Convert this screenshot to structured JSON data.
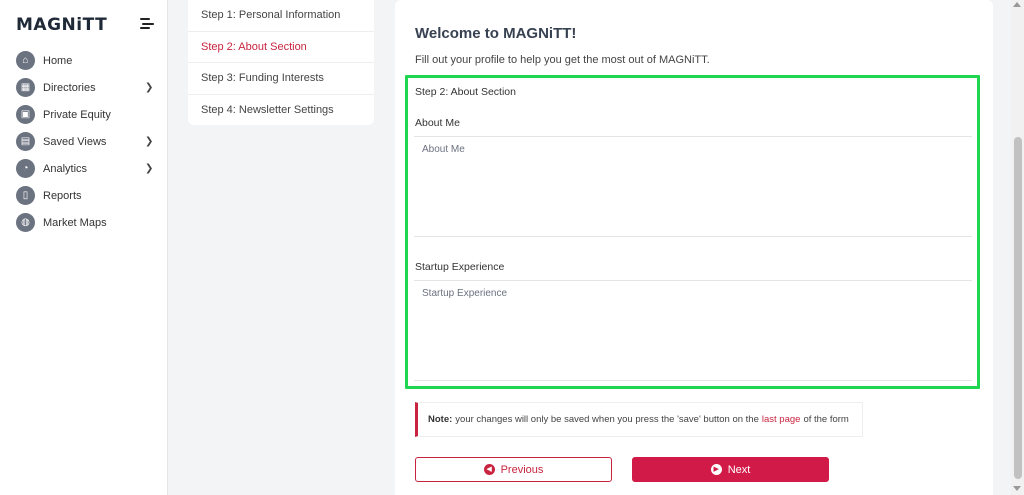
{
  "brand": {
    "logo_text": "MAGNiTT"
  },
  "sidebar": {
    "items": [
      {
        "label": "Home",
        "icon": "home-icon",
        "glyph": "⌂",
        "chevron": false
      },
      {
        "label": "Directories",
        "icon": "directory-icon",
        "glyph": "▦",
        "chevron": true
      },
      {
        "label": "Private Equity",
        "icon": "briefcase-icon",
        "glyph": "▣",
        "chevron": false
      },
      {
        "label": "Saved Views",
        "icon": "bookmark-icon",
        "glyph": "▤",
        "chevron": true
      },
      {
        "label": "Analytics",
        "icon": "pie-chart-icon",
        "glyph": "◔",
        "chevron": true
      },
      {
        "label": "Reports",
        "icon": "document-icon",
        "glyph": "▯",
        "chevron": false
      },
      {
        "label": "Market Maps",
        "icon": "globe-icon",
        "glyph": "◍",
        "chevron": false
      }
    ]
  },
  "steps": [
    {
      "label": "Step 1: Personal Information",
      "active": false
    },
    {
      "label": "Step 2: About Section",
      "active": true
    },
    {
      "label": "Step 3: Funding Interests",
      "active": false
    },
    {
      "label": "Step 4: Newsletter Settings",
      "active": false
    }
  ],
  "main": {
    "title": "Welcome to MAGNiTT!",
    "subtitle": "Fill out your profile to help you get the most out of MAGNiTT.",
    "section_title": "Step 2: About Section",
    "about_label": "About Me",
    "about_placeholder": "About Me",
    "about_value": "",
    "startup_label": "Startup Experience",
    "startup_placeholder": "Startup Experience",
    "startup_value": "",
    "note": {
      "bold": "Note:",
      "text_before": "your changes will only be saved when you press the 'save' button on the",
      "link": "last page",
      "text_after": "of the form"
    },
    "prev_label": "Previous",
    "next_label": "Next"
  },
  "colors": {
    "accent": "#d11a47",
    "highlight": "#20d650",
    "sidebar_icon": "#6b7280"
  }
}
